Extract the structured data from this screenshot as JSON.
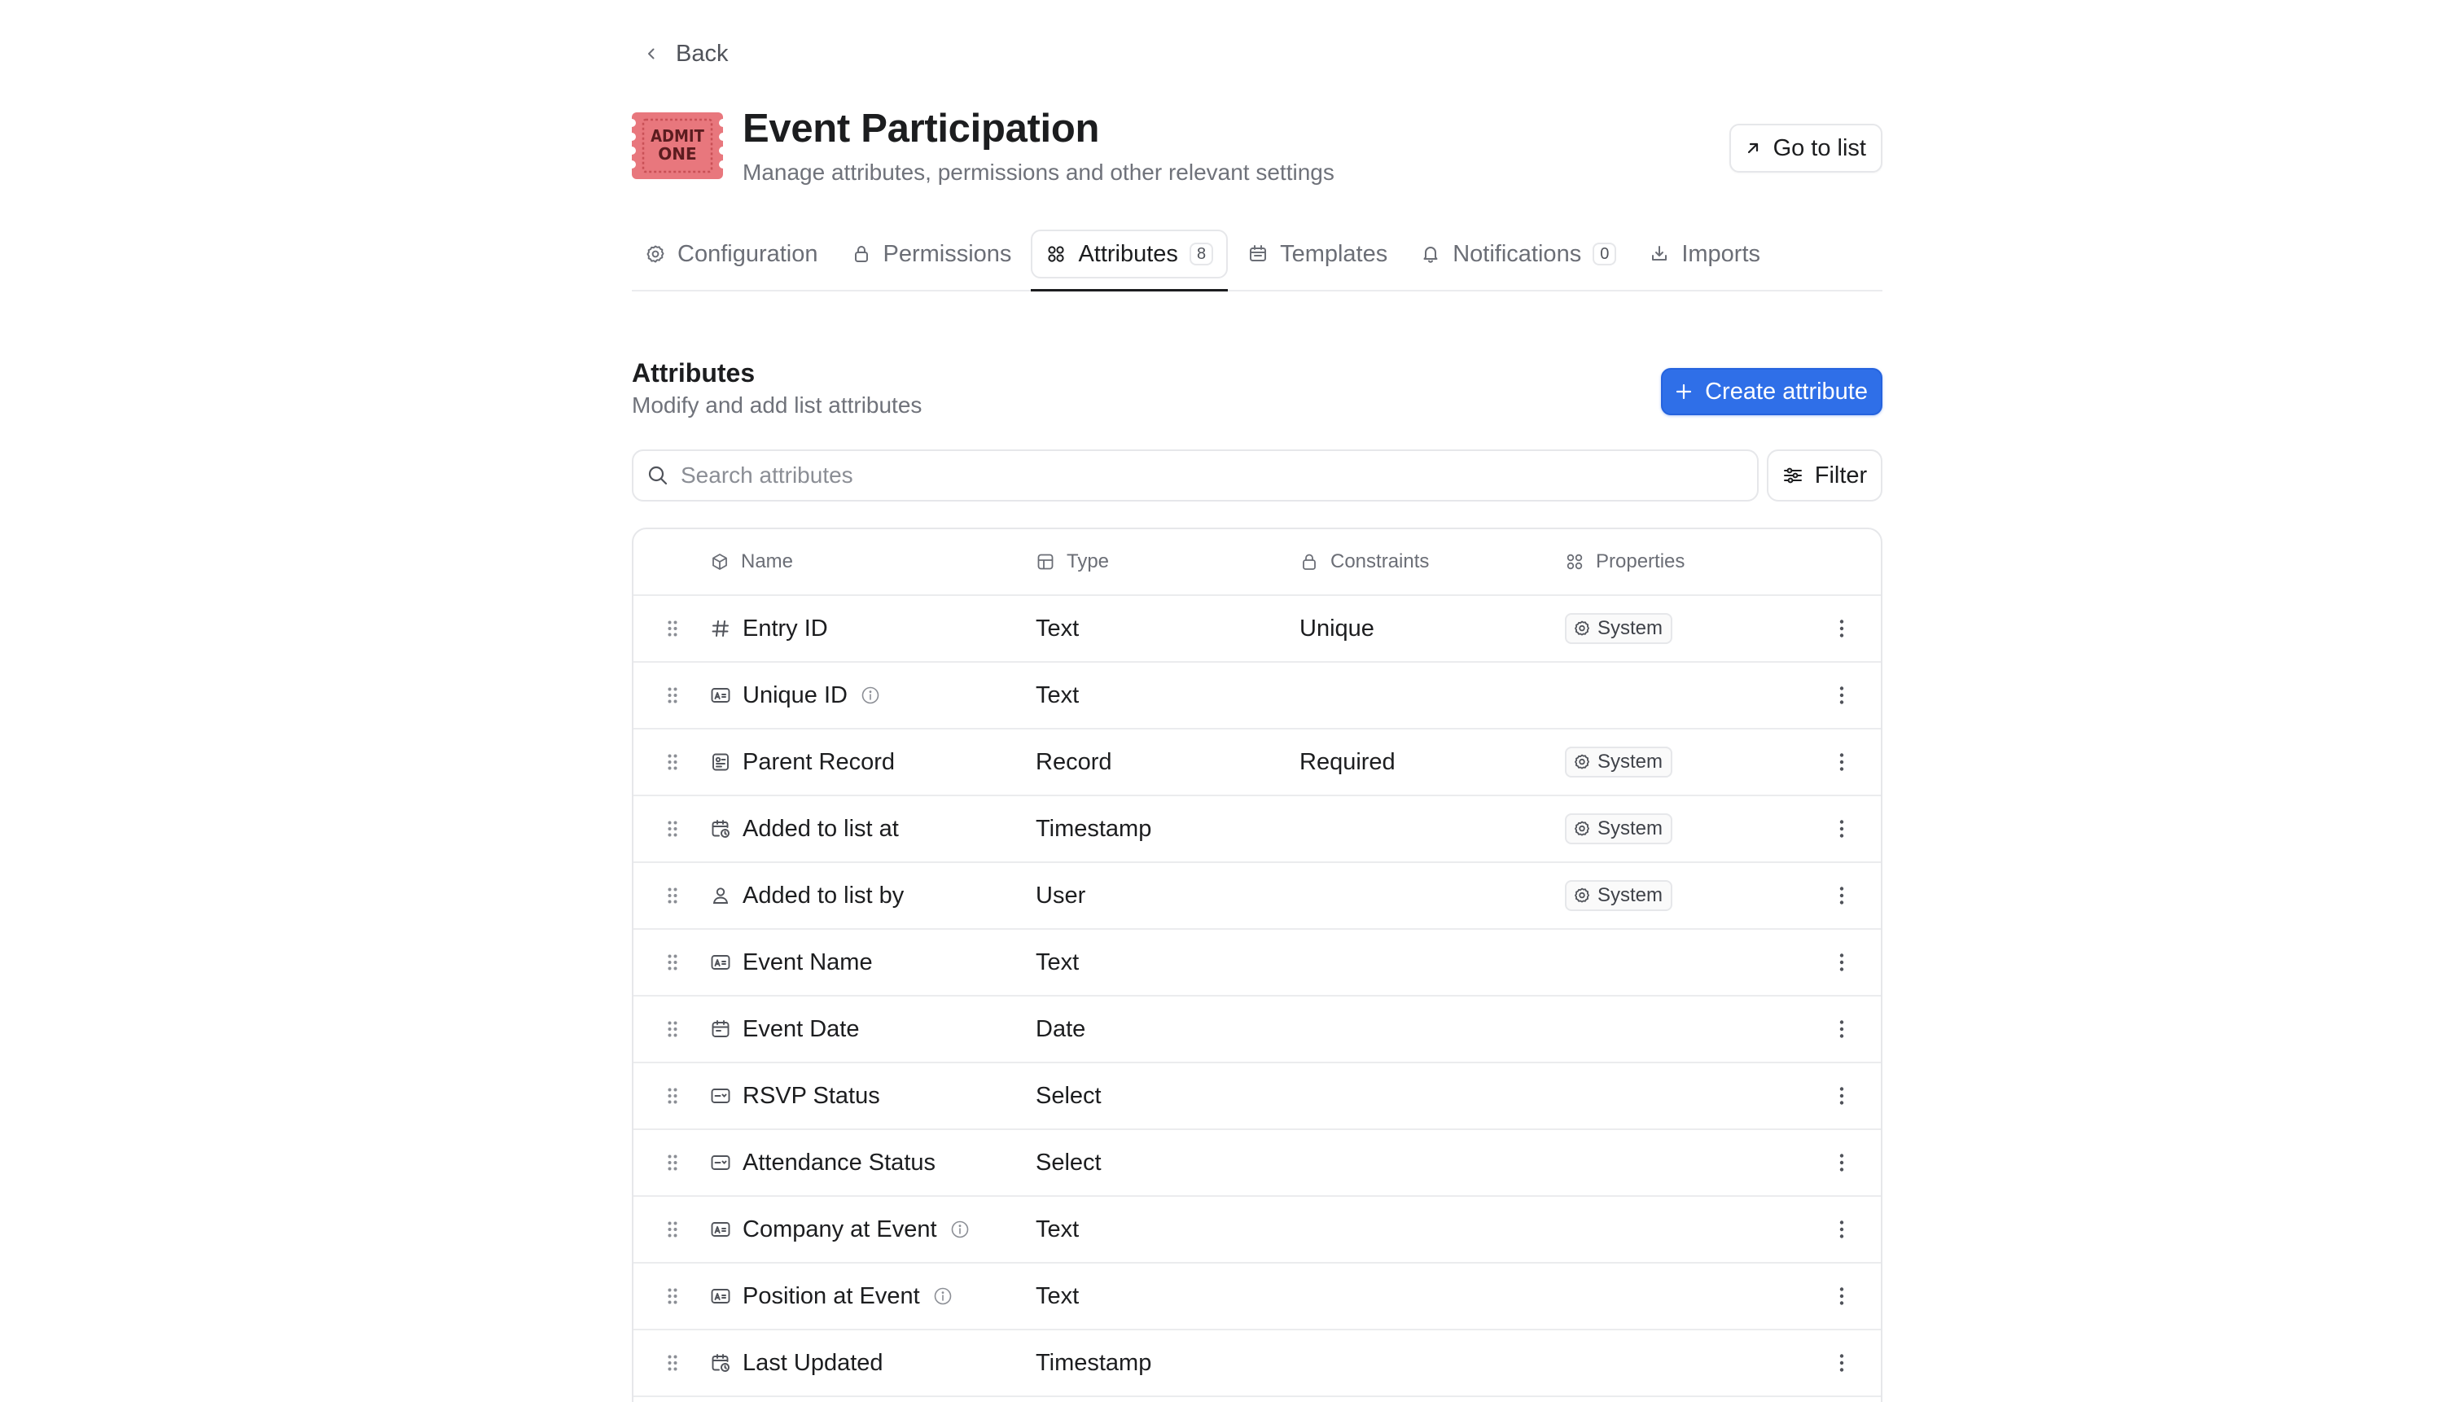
{
  "nav": {
    "back_label": "Back"
  },
  "header": {
    "title": "Event Participation",
    "subtitle": "Manage attributes, permissions and other relevant settings",
    "go_to_list_label": "Go to list",
    "icon_text": [
      "ADMIT",
      "ONE"
    ]
  },
  "tabs": [
    {
      "label": "Configuration",
      "icon": "gear-icon"
    },
    {
      "label": "Permissions",
      "icon": "lock-icon"
    },
    {
      "label": "Attributes",
      "icon": "grid-icon",
      "count": "8",
      "active": true
    },
    {
      "label": "Templates",
      "icon": "template-icon"
    },
    {
      "label": "Notifications",
      "icon": "bell-icon",
      "count": "0"
    },
    {
      "label": "Imports",
      "icon": "import-icon"
    }
  ],
  "section": {
    "title": "Attributes",
    "subtitle": "Modify and add list attributes",
    "create_label": "Create attribute"
  },
  "search": {
    "placeholder": "Search attributes",
    "value": ""
  },
  "filter_label": "Filter",
  "table": {
    "columns": {
      "name": "Name",
      "type": "Type",
      "constraints": "Constraints",
      "properties": "Properties"
    },
    "rows": [
      {
        "name": "Entry ID",
        "icon": "hash-icon",
        "type": "Text",
        "constraints": "Unique",
        "properties": "System",
        "info": false
      },
      {
        "name": "Unique ID",
        "icon": "text-field-icon",
        "type": "Text",
        "constraints": "",
        "properties": "",
        "info": true
      },
      {
        "name": "Parent Record",
        "icon": "record-icon",
        "type": "Record",
        "constraints": "Required",
        "properties": "System",
        "info": false
      },
      {
        "name": "Added to list at",
        "icon": "calendar-clock-icon",
        "type": "Timestamp",
        "constraints": "",
        "properties": "System",
        "info": false
      },
      {
        "name": "Added to list by",
        "icon": "user-icon",
        "type": "User",
        "constraints": "",
        "properties": "System",
        "info": false
      },
      {
        "name": "Event Name",
        "icon": "text-field-icon",
        "type": "Text",
        "constraints": "",
        "properties": "",
        "info": false
      },
      {
        "name": "Event Date",
        "icon": "calendar-icon",
        "type": "Date",
        "constraints": "",
        "properties": "",
        "info": false
      },
      {
        "name": "RSVP Status",
        "icon": "select-icon",
        "type": "Select",
        "constraints": "",
        "properties": "",
        "info": false
      },
      {
        "name": "Attendance Status",
        "icon": "select-icon",
        "type": "Select",
        "constraints": "",
        "properties": "",
        "info": false
      },
      {
        "name": "Company at Event",
        "icon": "text-field-icon",
        "type": "Text",
        "constraints": "",
        "properties": "",
        "info": true
      },
      {
        "name": "Position at Event",
        "icon": "text-field-icon",
        "type": "Text",
        "constraints": "",
        "properties": "",
        "info": true
      },
      {
        "name": "Last Updated",
        "icon": "calendar-clock-icon",
        "type": "Timestamp",
        "constraints": "",
        "properties": "",
        "info": false
      }
    ]
  },
  "colors": {
    "accent": "#2f6fe8",
    "ticket": "#e8777d",
    "text_primary": "#1c1d1f",
    "text_secondary": "#6f727a",
    "border": "#e6e7ea"
  }
}
